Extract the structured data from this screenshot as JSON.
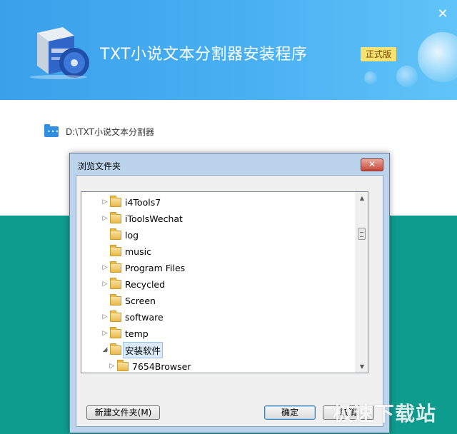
{
  "installer": {
    "title": "TXT小说文本分割器安装程序",
    "edition_badge": "正式版",
    "close_glyph": "✕",
    "install_path": "D:\\TXT小说文本分割器",
    "header_color": "#3aa0ea",
    "accent_color": "#0e9c8e"
  },
  "dialog": {
    "title": "浏览文件夹",
    "close_glyph": "✕",
    "tree": [
      {
        "label": "i4Tools7",
        "expander": "▷",
        "level": 1,
        "selected": false
      },
      {
        "label": "iToolsWechat",
        "expander": "▷",
        "level": 1,
        "selected": false
      },
      {
        "label": "log",
        "expander": "",
        "level": 1,
        "selected": false
      },
      {
        "label": "music",
        "expander": "",
        "level": 1,
        "selected": false
      },
      {
        "label": "Program Files",
        "expander": "▷",
        "level": 1,
        "selected": false
      },
      {
        "label": "Recycled",
        "expander": "▷",
        "level": 1,
        "selected": false
      },
      {
        "label": "Screen",
        "expander": "",
        "level": 1,
        "selected": false
      },
      {
        "label": "software",
        "expander": "▷",
        "level": 1,
        "selected": false
      },
      {
        "label": "temp",
        "expander": "▷",
        "level": 1,
        "selected": false
      },
      {
        "label": "安装软件",
        "expander": "◢",
        "level": 1,
        "selected": true
      },
      {
        "label": "7654Browser",
        "expander": "▷",
        "level": 2,
        "selected": false
      }
    ],
    "new_folder_button": "新建文件夹(M)",
    "ok_button": "确定",
    "cancel_button": "取消"
  },
  "watermark": "极速下载站"
}
